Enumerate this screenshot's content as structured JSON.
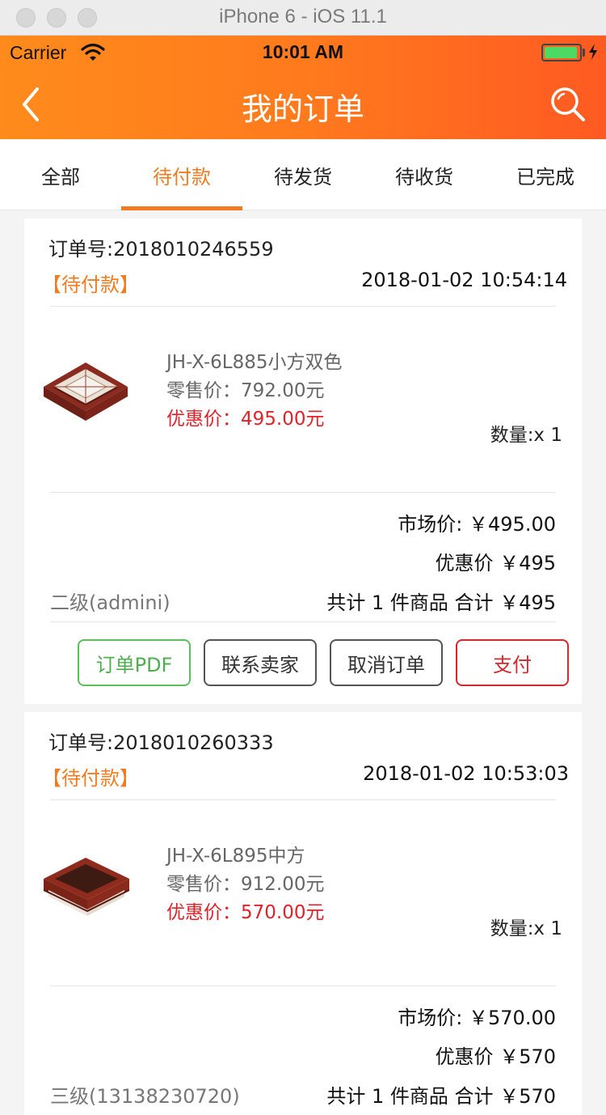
{
  "simulator": {
    "title": "iPhone 6 - iOS 11.1"
  },
  "status_bar": {
    "carrier": "Carrier",
    "time": "10:01 AM",
    "battery_color": "#4cd964"
  },
  "nav": {
    "title": "我的订单",
    "back_icon": "chevron-left-icon",
    "search_icon": "search-icon"
  },
  "tabs": [
    {
      "label": "全部",
      "active": false
    },
    {
      "label": "待付款",
      "active": true
    },
    {
      "label": "待发货",
      "active": false
    },
    {
      "label": "待收货",
      "active": false
    },
    {
      "label": "已完成",
      "active": false
    }
  ],
  "orders": [
    {
      "order_no": "订单号:2018010246559",
      "status": "【待付款】",
      "time": "2018-01-02 10:54:14",
      "item": {
        "name": "JH-X-6L885小方双色",
        "retail": "零售价：792.00元",
        "promo": "优惠价：495.00元",
        "qty": "数量:x 1"
      },
      "market_price": "市场价: ￥495.00",
      "discount_price": "优惠价 ￥495",
      "level": "二级(admini)",
      "total": "共计 1 件商品 合计 ￥495",
      "buttons": {
        "pdf": "订单PDF",
        "contact": "联系卖家",
        "cancel": "取消订单",
        "pay": "支付"
      }
    },
    {
      "order_no": "订单号:2018010260333",
      "status": "【待付款】",
      "time": "2018-01-02 10:53:03",
      "item": {
        "name": "JH-X-6L895中方",
        "retail": "零售价：912.00元",
        "promo": "优惠价：570.00元",
        "qty": "数量:x 1"
      },
      "market_price": "市场价: ￥570.00",
      "discount_price": "优惠价 ￥570",
      "level": "三级(13138230720)",
      "total": "共计 1 件商品 合计 ￥570"
    }
  ],
  "colors": {
    "accent": "#f27b22",
    "header_start": "#ff8b1c",
    "header_end": "#ff5a22",
    "promo_red": "#e0222b",
    "pdf_green": "#5bbf5b"
  }
}
